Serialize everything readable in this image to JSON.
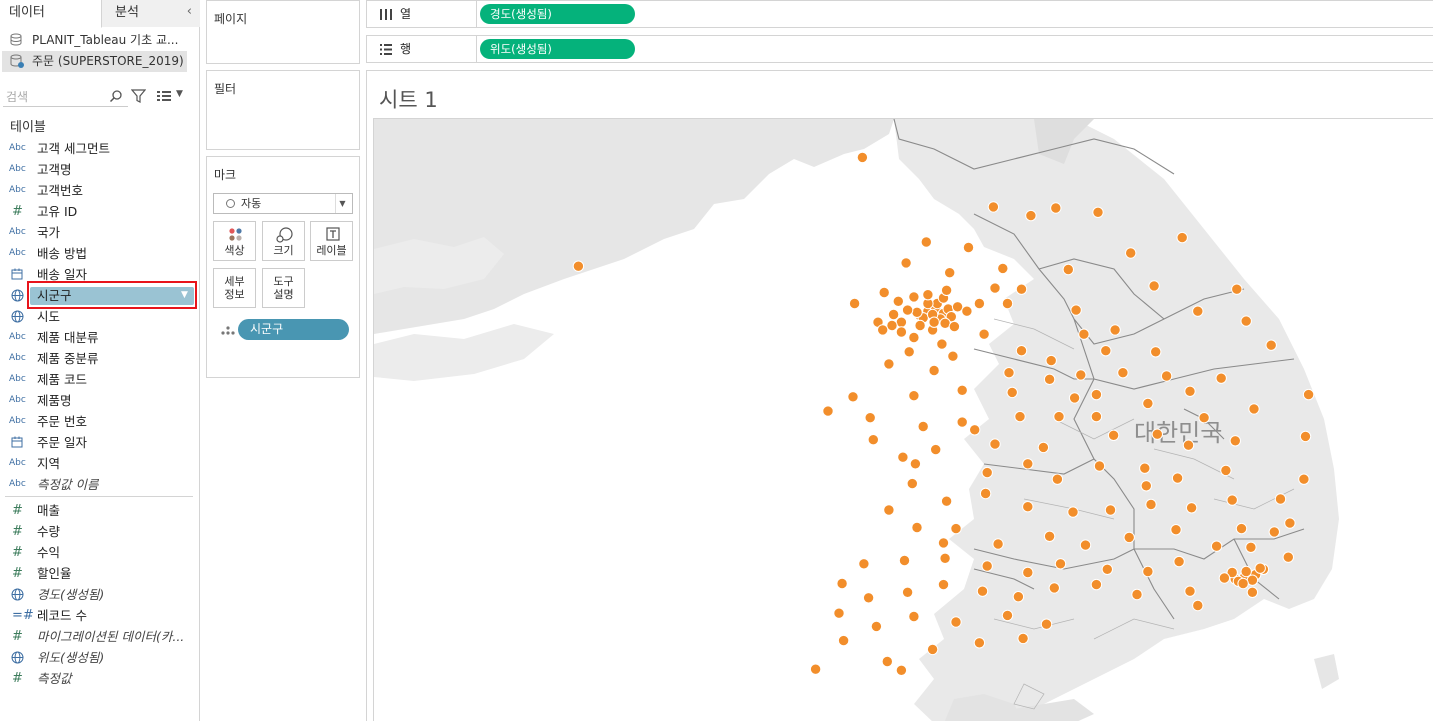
{
  "tabs": {
    "data": "데이터",
    "analysis": "분석",
    "collapse": "‹"
  },
  "sources": [
    {
      "name": "PLANIT_Tableau 기초 교...",
      "selected": false
    },
    {
      "name": "주문 (SUPERSTORE_2019)",
      "selected": true
    }
  ],
  "search": {
    "placeholder": "검색"
  },
  "tables_heading": "테이블",
  "dimensions": [
    {
      "type": "Abc",
      "name": "고객 세그먼트"
    },
    {
      "type": "Abc",
      "name": "고객명"
    },
    {
      "type": "Abc",
      "name": "고객번호"
    },
    {
      "type": "#",
      "name": "고유 ID"
    },
    {
      "type": "Abc",
      "name": "국가"
    },
    {
      "type": "Abc",
      "name": "배송 방법"
    },
    {
      "type": "date",
      "name": "배송 일자"
    },
    {
      "type": "geo",
      "name": "시군구",
      "selected": true
    },
    {
      "type": "geo",
      "name": "시도"
    },
    {
      "type": "Abc",
      "name": "제품 대분류"
    },
    {
      "type": "Abc",
      "name": "제품 중분류"
    },
    {
      "type": "Abc",
      "name": "제품 코드"
    },
    {
      "type": "Abc",
      "name": "제품명"
    },
    {
      "type": "Abc",
      "name": "주문 번호"
    },
    {
      "type": "date",
      "name": "주문 일자"
    },
    {
      "type": "Abc",
      "name": "지역"
    },
    {
      "type": "Abc",
      "name": "측정값 이름",
      "italic": true
    }
  ],
  "measures": [
    {
      "type": "#",
      "name": "매출"
    },
    {
      "type": "#",
      "name": "수량"
    },
    {
      "type": "#",
      "name": "수익"
    },
    {
      "type": "#",
      "name": "할인율"
    },
    {
      "type": "geo",
      "name": "경도(생성됨)",
      "italic": true
    },
    {
      "type": "=#",
      "name": "레코드 수"
    },
    {
      "type": "#",
      "name": "마이그레이션된 데이터(카...",
      "italic": true
    },
    {
      "type": "geo",
      "name": "위도(생성됨)",
      "italic": true
    },
    {
      "type": "#",
      "name": "측정값",
      "italic": true
    }
  ],
  "cards": {
    "pages": "페이지",
    "filters": "필터",
    "marks": "마크",
    "mark_type": "자동",
    "buttons": {
      "color": "색상",
      "size": "크기",
      "label": "레이블",
      "detail": "세부\n정보",
      "tooltip": "도구\n설명"
    },
    "detail_pill": "시군구"
  },
  "shelves": {
    "columns_label": "열",
    "rows_label": "행",
    "columns_pill": "경도(생성됨)",
    "rows_pill": "위도(생성됨)"
  },
  "sheet": {
    "title": "시트 1",
    "country_label": "대한민국"
  },
  "colors": {
    "mark": "#f28e2b",
    "pill_green": "#05b27b",
    "pill_blue": "#4996b2",
    "highlight": "#9ac3d3",
    "red": "#e8141b"
  },
  "chart_data": {
    "type": "scatter",
    "title": "시트 1",
    "xlabel": "경도(생성됨)",
    "ylabel": "위도(생성됨)",
    "detail": "시군구",
    "mark_color": "#f28e2b",
    "points": [
      [
        126.53,
        38.95
      ],
      [
        127.37,
        38.5
      ],
      [
        127.77,
        38.49
      ],
      [
        128.04,
        38.45
      ],
      [
        127.61,
        38.42
      ],
      [
        126.94,
        38.18
      ],
      [
        127.21,
        38.13
      ],
      [
        126.81,
        37.99
      ],
      [
        127.09,
        37.9
      ],
      [
        127.43,
        37.94
      ],
      [
        127.85,
        37.93
      ],
      [
        127.55,
        37.75
      ],
      [
        128.25,
        38.08
      ],
      [
        128.58,
        38.22
      ],
      [
        128.93,
        37.75
      ],
      [
        128.4,
        37.78
      ],
      [
        128.68,
        37.55
      ],
      [
        128.99,
        37.46
      ],
      [
        129.15,
        37.24
      ],
      [
        128.41,
        37.18
      ],
      [
        128.15,
        37.38
      ],
      [
        127.95,
        37.34
      ],
      [
        127.9,
        37.56
      ],
      [
        127.46,
        37.62
      ],
      [
        127.31,
        37.34
      ],
      [
        127.55,
        37.19
      ],
      [
        127.74,
        37.1
      ],
      [
        127.11,
        37.14
      ],
      [
        126.67,
        37.72
      ],
      [
        126.48,
        37.62
      ],
      [
        126.96,
        37.6
      ],
      [
        126.9,
        37.51
      ],
      [
        126.78,
        37.45
      ],
      [
        126.98,
        37.38
      ],
      [
        126.86,
        37.31
      ],
      [
        127.04,
        37.25
      ],
      [
        126.83,
        37.18
      ],
      [
        127.28,
        37.62
      ],
      [
        127.38,
        37.76
      ],
      [
        126.99,
        37.01
      ],
      [
        126.7,
        37.07
      ],
      [
        127.47,
        36.99
      ],
      [
        127.17,
        36.83
      ],
      [
        126.86,
        36.78
      ],
      [
        126.47,
        36.77
      ],
      [
        126.31,
        36.64
      ],
      [
        126.58,
        36.58
      ],
      [
        126.92,
        36.5
      ],
      [
        126.6,
        36.38
      ],
      [
        127.0,
        36.29
      ],
      [
        127.25,
        36.47
      ],
      [
        127.54,
        36.59
      ],
      [
        127.73,
        36.93
      ],
      [
        127.93,
        36.97
      ],
      [
        128.2,
        36.99
      ],
      [
        127.49,
        36.81
      ],
      [
        127.89,
        36.76
      ],
      [
        128.03,
        36.59
      ],
      [
        128.36,
        36.71
      ],
      [
        128.63,
        36.82
      ],
      [
        129.04,
        36.66
      ],
      [
        129.39,
        36.79
      ],
      [
        128.72,
        36.58
      ],
      [
        129.37,
        36.41
      ],
      [
        128.92,
        36.37
      ],
      [
        128.62,
        36.33
      ],
      [
        128.42,
        36.43
      ],
      [
        128.14,
        36.42
      ],
      [
        127.69,
        36.31
      ],
      [
        127.38,
        36.34
      ],
      [
        127.33,
        36.08
      ],
      [
        127.59,
        36.16
      ],
      [
        127.78,
        36.02
      ],
      [
        128.05,
        36.14
      ],
      [
        128.34,
        36.12
      ],
      [
        128.55,
        36.03
      ],
      [
        128.86,
        36.1
      ],
      [
        129.36,
        36.02
      ],
      [
        129.21,
        35.84
      ],
      [
        128.9,
        35.83
      ],
      [
        128.64,
        35.76
      ],
      [
        128.38,
        35.79
      ],
      [
        128.12,
        35.74
      ],
      [
        127.88,
        35.72
      ],
      [
        127.59,
        35.77
      ],
      [
        127.32,
        35.89
      ],
      [
        127.07,
        35.82
      ],
      [
        126.85,
        35.98
      ],
      [
        126.7,
        35.74
      ],
      [
        126.88,
        35.58
      ],
      [
        127.13,
        35.57
      ],
      [
        127.4,
        35.43
      ],
      [
        127.73,
        35.5
      ],
      [
        127.96,
        35.42
      ],
      [
        128.24,
        35.49
      ],
      [
        128.54,
        35.56
      ],
      [
        128.96,
        35.57
      ],
      [
        129.27,
        35.62
      ],
      [
        128.8,
        35.41
      ],
      [
        128.56,
        35.27
      ],
      [
        128.36,
        35.18
      ],
      [
        128.1,
        35.2
      ],
      [
        127.8,
        35.25
      ],
      [
        127.59,
        35.17
      ],
      [
        127.33,
        35.23
      ],
      [
        127.06,
        35.3
      ],
      [
        126.8,
        35.28
      ],
      [
        126.54,
        35.25
      ],
      [
        126.4,
        35.07
      ],
      [
        126.57,
        34.94
      ],
      [
        126.82,
        34.99
      ],
      [
        127.05,
        35.06
      ],
      [
        127.3,
        35.0
      ],
      [
        127.53,
        34.95
      ],
      [
        127.76,
        35.03
      ],
      [
        128.03,
        35.06
      ],
      [
        128.29,
        34.97
      ],
      [
        128.63,
        35.0
      ],
      [
        128.92,
        35.11
      ],
      [
        129.1,
        35.2
      ],
      [
        129.17,
        35.54
      ],
      [
        129.26,
        35.31
      ],
      [
        126.38,
        34.8
      ],
      [
        126.62,
        34.68
      ],
      [
        126.86,
        34.77
      ],
      [
        127.13,
        34.72
      ],
      [
        127.46,
        34.78
      ],
      [
        127.71,
        34.7
      ],
      [
        126.41,
        34.55
      ],
      [
        126.69,
        34.36
      ],
      [
        126.98,
        34.47
      ],
      [
        127.28,
        34.53
      ],
      [
        127.56,
        34.57
      ],
      [
        126.23,
        34.29
      ],
      [
        126.78,
        34.28
      ],
      [
        128.09,
        37.19
      ],
      [
        128.48,
        36.96
      ],
      [
        128.83,
        36.94
      ],
      [
        127.17,
        36.54
      ],
      [
        126.79,
        36.22
      ],
      [
        128.03,
        36.79
      ],
      [
        127.79,
        36.59
      ],
      [
        126.87,
        36.16
      ],
      [
        124.71,
        37.96
      ],
      [
        128.35,
        35.96
      ],
      [
        127.05,
        35.44
      ],
      [
        128.68,
        34.87
      ],
      [
        129.02,
        35.4
      ],
      [
        129.03,
        34.99
      ]
    ],
    "cluster_points": [
      [
        126.95,
        37.55
      ],
      [
        127.0,
        37.57
      ],
      [
        127.05,
        37.53
      ],
      [
        126.92,
        37.49
      ],
      [
        127.03,
        37.48
      ],
      [
        126.98,
        37.52
      ],
      [
        127.08,
        37.57
      ],
      [
        126.88,
        37.54
      ],
      [
        127.01,
        37.62
      ],
      [
        126.95,
        37.62
      ],
      [
        127.1,
        37.5
      ],
      [
        127.06,
        37.44
      ],
      [
        126.82,
        37.56
      ],
      [
        126.73,
        37.52
      ],
      [
        126.72,
        37.42
      ],
      [
        126.63,
        37.45
      ],
      [
        126.66,
        37.38
      ],
      [
        126.78,
        37.36
      ],
      [
        127.12,
        37.41
      ],
      [
        127.14,
        37.59
      ],
      [
        127.2,
        37.55
      ],
      [
        126.9,
        37.42
      ],
      [
        126.99,
        37.45
      ],
      [
        127.05,
        37.67
      ],
      [
        126.86,
        37.68
      ],
      [
        126.76,
        37.64
      ],
      [
        126.95,
        37.7
      ],
      [
        127.07,
        37.74
      ],
      [
        128.98,
        35.13
      ],
      [
        128.94,
        35.09
      ],
      [
        129.05,
        35.15
      ],
      [
        128.99,
        35.18
      ],
      [
        128.9,
        35.17
      ],
      [
        129.03,
        35.1
      ],
      [
        128.97,
        35.07
      ],
      [
        129.08,
        35.21
      ],
      [
        128.85,
        35.12
      ]
    ],
    "xlim": [
      123.4,
      130.2
    ],
    "ylim": [
      33.8,
      39.3
    ]
  }
}
